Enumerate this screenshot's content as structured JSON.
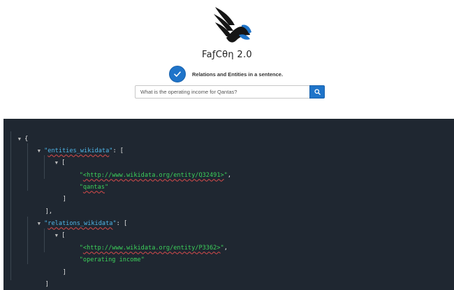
{
  "app": {
    "brand": "FaƒCθη 2.0",
    "mode_label": "Relations and Entities in a sentence.",
    "accent_color": "#1f74c9"
  },
  "search": {
    "value": "What is the operating income for Qantas?",
    "button_icon": "search-icon"
  },
  "json_view": {
    "keys": [
      "entities_wikidata",
      "relations_wikidata"
    ],
    "entities_wikidata": [
      [
        "<http://www.wikidata.org/entity/Q32491>",
        "qantas"
      ]
    ],
    "relations_wikidata": [
      [
        "<http://www.wikidata.org/entity/P3362>",
        "operating income"
      ]
    ],
    "tokens": {
      "open_brace": "{",
      "close_brace": "}",
      "open_bracket": "[",
      "close_bracket": "]",
      "close_bracket_comma": "],",
      "colon_bracket": ": [",
      "comma": ","
    },
    "colors": {
      "background": "#1f2731",
      "key": "#4fb6e8",
      "string": "#3ccf5a"
    }
  }
}
